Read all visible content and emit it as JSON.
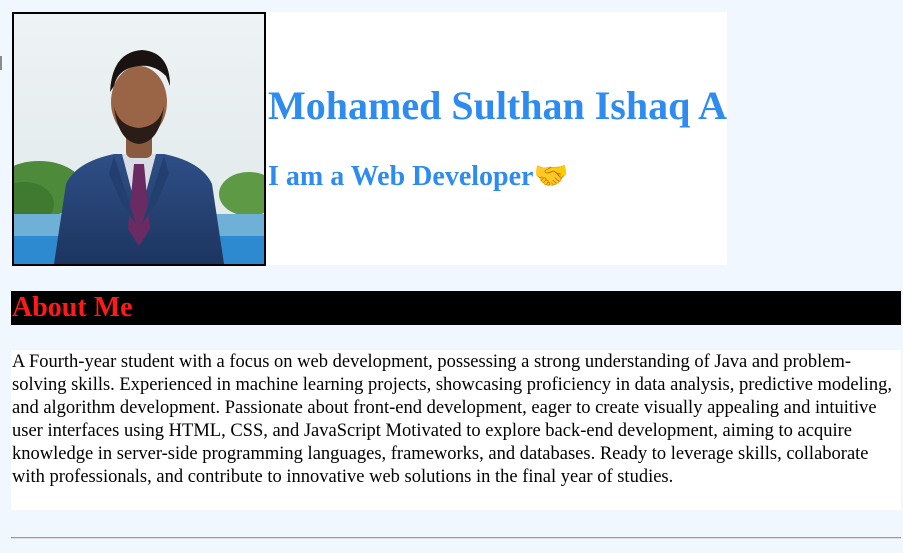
{
  "profile": {
    "name": "Mohamed Sulthan Ishaq A",
    "tagline": "I am a Web Developer",
    "tagline_emoji": "🤝"
  },
  "about": {
    "heading": "About Me",
    "text": "A Fourth-year student with a focus on web development, possessing a strong understanding of Java and problem-solving skills. Experienced in machine learning projects, showcasing proficiency in data analysis, predictive modeling, and algorithm development. Passionate about front-end development, eager to create visually appealing and intuitive user interfaces using HTML, CSS, and JavaScript Motivated to explore back-end development, aiming to acquire knowledge in server-side programming languages, frameworks, and databases. Ready to leverage skills, collaborate with professionals, and contribute to innovative web solutions in the final year of studies."
  },
  "colors": {
    "page_background": "#f0f7fe",
    "name_color": "#2e8bf0",
    "about_heading_color": "#ff1a1a",
    "about_bar_color": "#000000"
  }
}
